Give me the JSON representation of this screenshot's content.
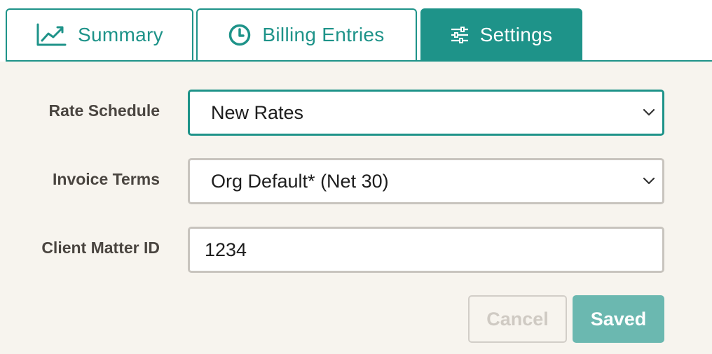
{
  "tabs": {
    "summary": {
      "label": "Summary",
      "icon": "trend-chart-icon"
    },
    "billing": {
      "label": "Billing Entries",
      "icon": "clock-icon"
    },
    "settings": {
      "label": "Settings",
      "icon": "sliders-icon",
      "active": true
    }
  },
  "form": {
    "rate_schedule": {
      "label": "Rate Schedule",
      "value": "New Rates"
    },
    "invoice_terms": {
      "label": "Invoice Terms",
      "value": "Org Default* (Net 30)"
    },
    "client_matter_id": {
      "label": "Client Matter ID",
      "value": "1234"
    }
  },
  "actions": {
    "cancel_label": "Cancel",
    "saved_label": "Saved"
  },
  "colors": {
    "accent": "#1e9389",
    "accent_light": "#6bb8b0",
    "background": "#f7f4ee",
    "label_text": "#4a4540"
  }
}
